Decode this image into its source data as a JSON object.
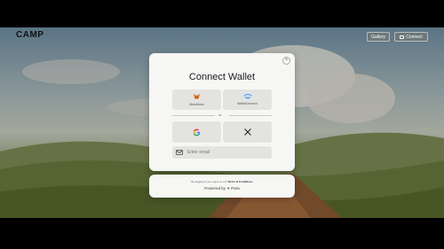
{
  "header": {
    "logo": "CAMP",
    "gallery_label": "Gallery",
    "connect_label": "Connect"
  },
  "modal": {
    "title": "Connect Wallet",
    "close_symbol": "×",
    "wallets": [
      {
        "label": "MetaMask"
      },
      {
        "label": "WalletConnect"
      }
    ],
    "divider_text": "or",
    "email_placeholder": "Enter email"
  },
  "footer": {
    "terms_prefix": "By logging in you agree to our",
    "terms_link": "Terms & Conditions",
    "powered_by": "Powered by",
    "brand": "Para"
  },
  "colors": {
    "accent": "#1d1d1d",
    "panel": "#f6f6f5",
    "tile": "#e3e3e2"
  }
}
